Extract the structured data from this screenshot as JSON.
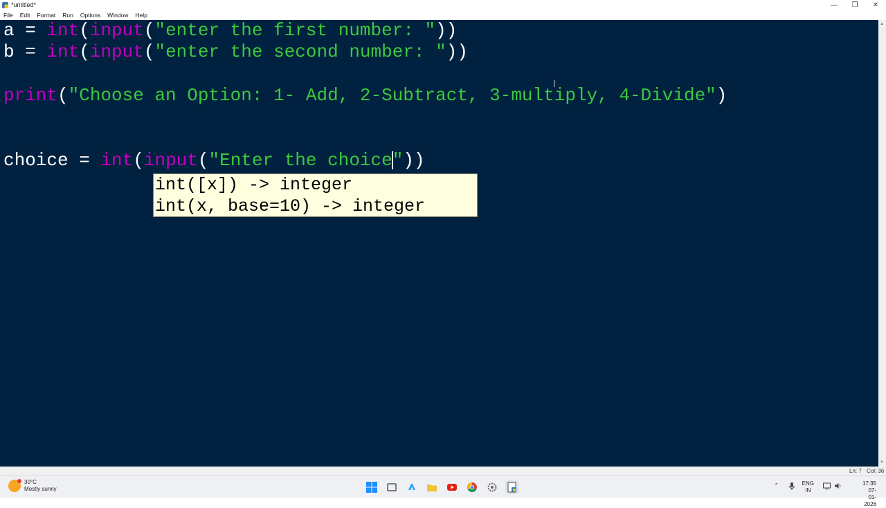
{
  "window": {
    "title": "*untitled*"
  },
  "menu": [
    "File",
    "Edit",
    "Format",
    "Run",
    "Options",
    "Window",
    "Help"
  ],
  "editor": {
    "line1": {
      "var": "a",
      "eq": " = ",
      "fn_int": "int",
      "p1": "(",
      "fn_input": "input",
      "p2": "(",
      "str": "\"enter the first number: \"",
      "close": "))"
    },
    "line2": {
      "var": "b",
      "eq": " = ",
      "fn_int": "int",
      "p1": "(",
      "fn_input": "input",
      "p2": "(",
      "str": "\"enter the second number: \"",
      "close": "))"
    },
    "line4": {
      "fn_print": "print",
      "p1": "(",
      "str": "\"Choose an Option: 1- Add, 2-Subtract, 3-multiply, 4-Divide\"",
      "close": ")"
    },
    "line7": {
      "var": "choice",
      "eq": " = ",
      "fn_int": "int",
      "p1": "(",
      "fn_input": "input",
      "p2": "(",
      "str_before": "\"Enter the choice",
      "str_after": "\"",
      "close": "))"
    },
    "calltip": [
      "int([x]) -> integer",
      "int(x, base=10) -> integer"
    ]
  },
  "status": {
    "line": "Ln: 7",
    "col": "Col: 36"
  },
  "taskbar": {
    "weather_temp": "30°C",
    "weather_desc": "Mostly sunny",
    "lang1": "ENG",
    "lang2": "IN",
    "time": "17:35",
    "date": "07-01-2026"
  },
  "colors": {
    "editor_bg": "#002240",
    "keyword": "#c000c0",
    "string": "#3ec83e",
    "calltip_bg": "#ffffe0"
  }
}
